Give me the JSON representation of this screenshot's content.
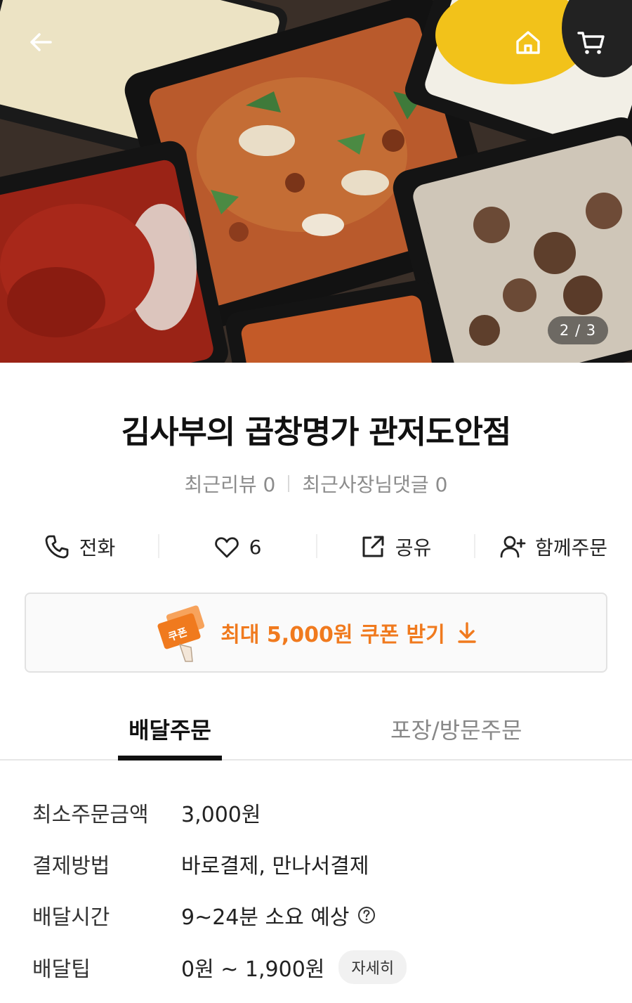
{
  "hero": {
    "page_counter": "2 / 3",
    "icons": [
      "arrow-left-icon",
      "home-icon",
      "cart-icon"
    ]
  },
  "store": {
    "title": "김사부의 곱창명가 관저도안점",
    "recent_reviews": "최근리뷰 0",
    "recent_owner_replies": "최근사장님댓글 0"
  },
  "actions": {
    "call_label": "전화",
    "like_count": "6",
    "share_label": "공유",
    "group_order_label": "함께주문"
  },
  "coupon": {
    "label": "최대 5,000원 쿠폰 받기",
    "ticket_text": "쿠폰",
    "accent_color": "#f07a1e"
  },
  "tabs": {
    "delivery": "배달주문",
    "pickup": "포장/방문주문"
  },
  "info": {
    "min_order_label": "최소주문금액",
    "min_order_value": "3,000원",
    "payment_label": "결제방법",
    "payment_value": "바로결제, 만나서결제",
    "delivery_time_label": "배달시간",
    "delivery_time_value": "9~24분 소요 예상",
    "delivery_tip_label": "배달팁",
    "delivery_tip_value": "0원 ~ 1,900원",
    "detail_button": "자세히"
  }
}
